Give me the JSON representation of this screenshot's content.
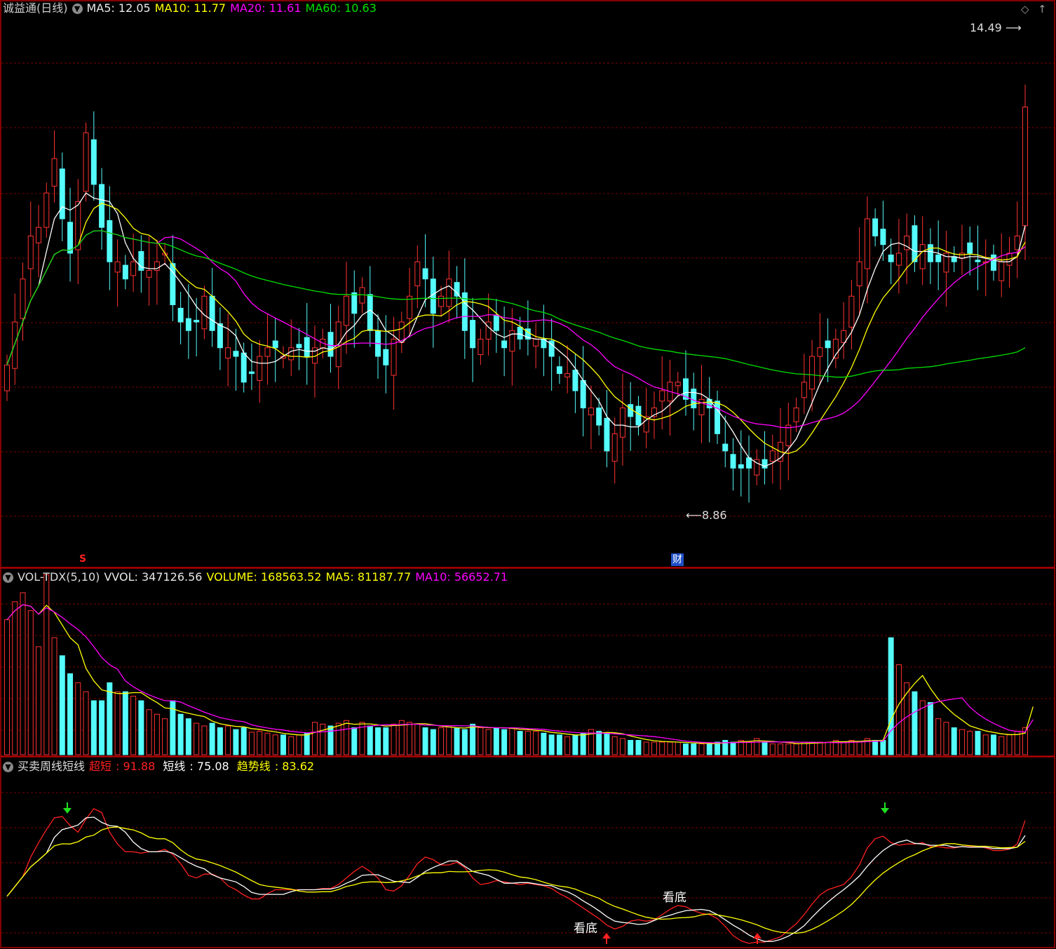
{
  "header": {
    "title": "诚益通(日线)",
    "ma5": "MA5: 12.05",
    "ma10": "MA10: 11.77",
    "ma20": "MA20: 11.61",
    "ma60": "MA60: 10.63"
  },
  "vol_header": {
    "name": "VOL-TDX(5,10)",
    "vvol": "VVOL: 347126.56",
    "volume": "VOLUME: 168563.52",
    "ma5": "MA5: 81187.77",
    "ma10": "MA10: 56652.71"
  },
  "ind_header": {
    "name": "买卖周线短线",
    "chaoduan_label": "超短",
    "chaoduan_value": ": 91.88",
    "duanxian_label": "短线",
    "duanxian_value": ": 75.08",
    "qushi_label": "趋势线",
    "qushi_value": ": 83.62"
  },
  "annotations": {
    "high": "14.49",
    "low": "8.86",
    "cai": "财",
    "s_mark": "S",
    "kandi": "看底"
  },
  "colors": {
    "up": "#ff3232",
    "down": "#54fcfc",
    "ma5": "#ffffff",
    "ma10": "#ffff00",
    "ma20": "#ff00ff",
    "ma60": "#00e000",
    "grid": "#7a0000",
    "border": "#b00000"
  },
  "chart_data": [
    {
      "type": "candlestick",
      "title": "诚益通(日线)",
      "close": [
        10.8,
        11.3,
        11.8,
        12.3,
        12.4,
        12.8,
        13.2,
        12.5,
        12.1,
        12.7,
        13.5,
        12.9,
        12.4,
        12.0,
        12.0,
        11.8,
        12.0,
        11.9,
        11.9,
        12.0,
        12.1,
        11.5,
        11.3,
        11.2,
        11.3,
        11.6,
        11.2,
        11.0,
        11.0,
        10.9,
        10.6,
        10.7,
        10.9,
        11.0,
        11.0,
        10.9,
        11.0,
        11.0,
        10.9,
        11.0,
        11.1,
        10.9,
        11.3,
        11.6,
        11.4,
        11.7,
        11.2,
        10.9,
        10.8,
        11.1,
        11.3,
        11.6,
        12.0,
        11.8,
        11.4,
        11.6,
        11.8,
        11.6,
        11.2,
        11.0,
        11.1,
        11.3,
        11.2,
        11.0,
        11.2,
        11.1,
        11.1,
        11.1,
        11.0,
        10.9,
        10.7,
        10.7,
        10.5,
        10.3,
        10.3,
        10.1,
        9.8,
        10.0,
        10.3,
        10.2,
        10.1,
        10.2,
        10.3,
        10.5,
        10.6,
        10.6,
        10.4,
        10.3,
        10.4,
        10.3,
        10.0,
        9.8,
        9.6,
        9.6,
        9.6,
        9.7,
        9.6,
        9.8,
        9.9,
        10.1,
        10.3,
        10.6,
        10.9,
        11.0,
        11.0,
        11.1,
        11.2,
        11.6,
        12.0,
        12.5,
        12.3,
        12.2,
        12.0,
        12.1,
        12.3,
        12.0,
        12.2,
        12.0,
        12.0,
        12.1,
        12.0,
        12.1,
        12.1,
        12.0,
        12.0,
        11.9,
        12.0,
        12.1,
        12.3,
        13.8
      ],
      "volume": [
        150,
        170,
        180,
        160,
        120,
        200,
        130,
        110,
        90,
        80,
        70,
        60,
        60,
        80,
        70,
        70,
        65,
        60,
        50,
        45,
        40,
        60,
        45,
        40,
        35,
        32,
        35,
        30,
        32,
        28,
        30,
        25,
        26,
        24,
        22,
        22,
        20,
        22,
        24,
        36,
        34,
        32,
        35,
        38,
        30,
        36,
        32,
        30,
        30,
        34,
        38,
        36,
        34,
        30,
        28,
        30,
        32,
        30,
        28,
        34,
        30,
        28,
        30,
        28,
        30,
        26,
        26,
        26,
        24,
        22,
        22,
        20,
        22,
        24,
        28,
        26,
        24,
        20,
        18,
        16,
        16,
        14,
        14,
        14,
        14,
        14,
        12,
        12,
        12,
        12,
        14,
        16,
        14,
        16,
        14,
        18,
        14,
        12,
        12,
        12,
        12,
        14,
        14,
        14,
        14,
        16,
        14,
        16,
        14,
        18,
        16,
        16,
        130,
        100,
        80,
        70,
        60,
        58,
        40,
        36,
        30,
        28,
        26,
        26,
        22,
        22,
        20,
        22,
        26,
        30,
        168.56
      ],
      "ma5": [
        12.05
      ],
      "ma10": [
        11.77
      ],
      "ma20": [
        11.61
      ],
      "ma60": [
        10.63
      ],
      "high_label": 14.49,
      "low_label": 8.86
    },
    {
      "type": "line",
      "title": "买卖周线短线",
      "series": [
        {
          "name": "超短",
          "last": 91.88
        },
        {
          "name": "短线",
          "last": 75.08
        },
        {
          "name": "趋势线",
          "last": 83.62
        }
      ]
    }
  ]
}
